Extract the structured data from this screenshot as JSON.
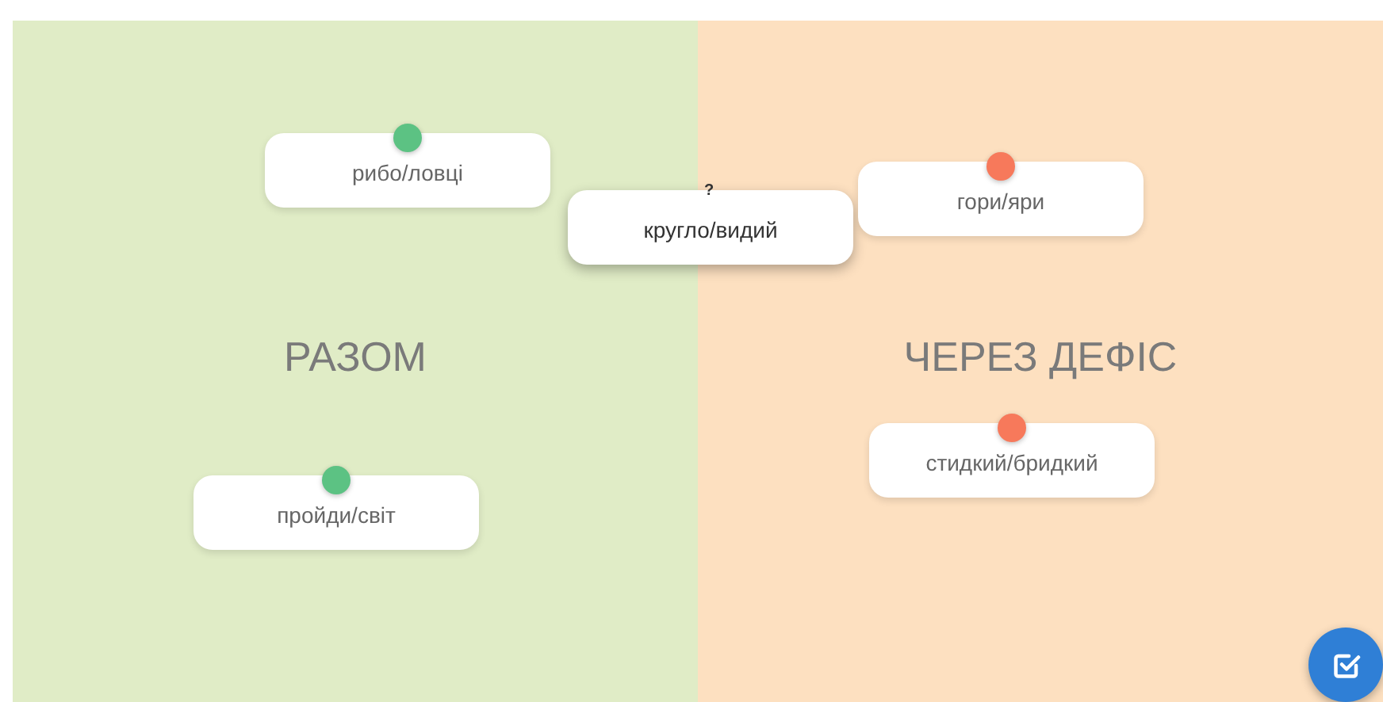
{
  "zones": [
    {
      "label": "РАЗОМ"
    },
    {
      "label": "ЧЕРЕЗ ДЕФІС"
    }
  ],
  "cards": [
    {
      "text": "рибо/ловці",
      "kind": "placed",
      "color": "#5cc283"
    },
    {
      "text": "кругло/видий",
      "kind": "current",
      "marker": "?"
    },
    {
      "text": "гори/яри",
      "kind": "placed",
      "color": "#f7795b"
    },
    {
      "text": "пройди/світ",
      "kind": "placed",
      "color": "#5cc283"
    },
    {
      "text": "стидкий/бридкий",
      "kind": "placed",
      "color": "#f7795b"
    }
  ]
}
